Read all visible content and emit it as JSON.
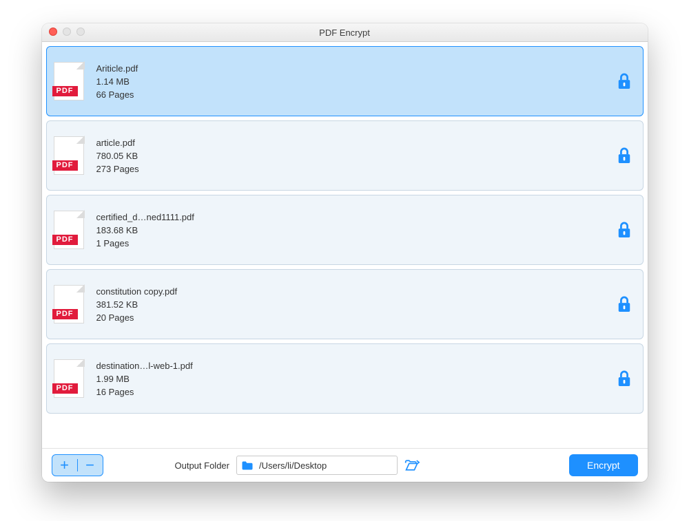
{
  "window": {
    "title": "PDF Encrypt"
  },
  "pdf_badge": "PDF",
  "files": [
    {
      "name": "Ariticle.pdf",
      "size": "1.14 MB",
      "pages": "66 Pages",
      "selected": true
    },
    {
      "name": "article.pdf",
      "size": "780.05 KB",
      "pages": "273 Pages",
      "selected": false
    },
    {
      "name": "certified_d…ned1111.pdf",
      "size": "183.68 KB",
      "pages": "1 Pages",
      "selected": false
    },
    {
      "name": "constitution copy.pdf",
      "size": "381.52 KB",
      "pages": "20 Pages",
      "selected": false
    },
    {
      "name": "destination…l-web-1.pdf",
      "size": "1.99 MB",
      "pages": "16 Pages",
      "selected": false
    }
  ],
  "toolbar": {
    "add_label": "+",
    "remove_label": "−",
    "output_label": "Output Folder",
    "output_path": "/Users/li/Desktop",
    "encrypt_label": "Encrypt"
  },
  "colors": {
    "accent": "#1e90ff",
    "selected_bg": "#c2e2fb",
    "row_bg": "#eff5fa",
    "pdf_red": "#e11b3c"
  }
}
